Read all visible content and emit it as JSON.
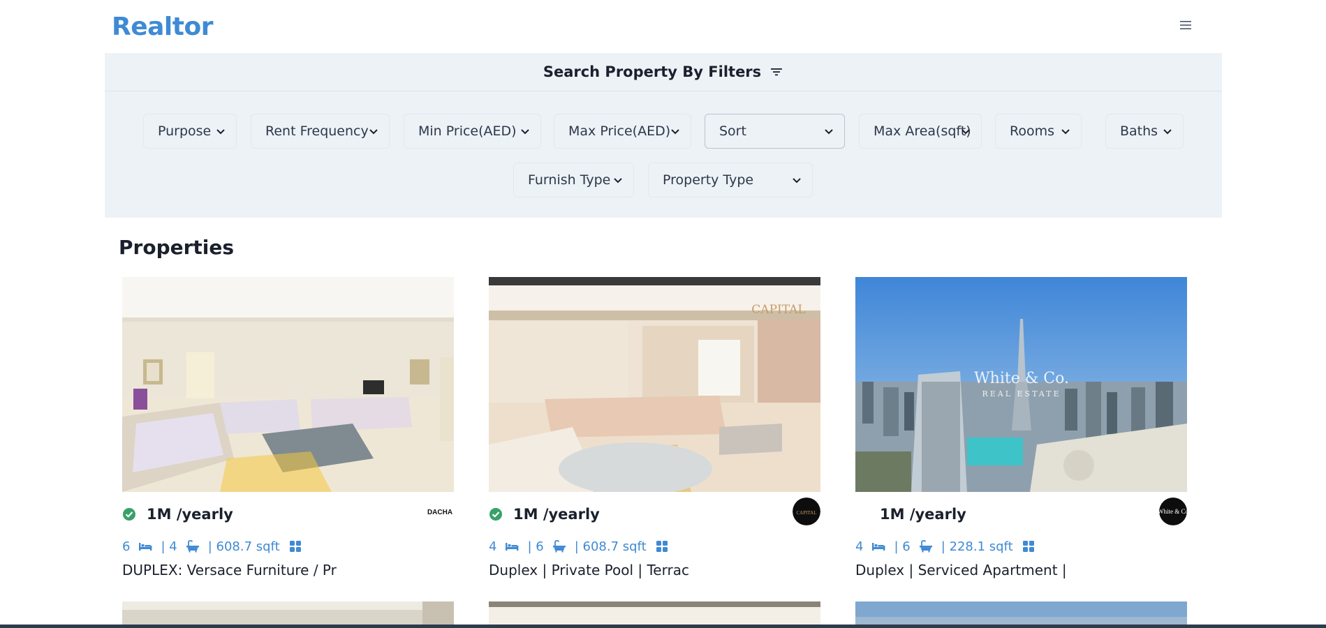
{
  "app": {
    "title": "Realtor"
  },
  "filters": {
    "heading": "Search Property By Filters",
    "items": [
      {
        "label": "Purpose"
      },
      {
        "label": "Rent Frequency"
      },
      {
        "label": "Min Price(AED)"
      },
      {
        "label": "Max Price(AED)"
      },
      {
        "label": "Sort"
      },
      {
        "label": "Max Area(sqft)"
      },
      {
        "label": "Rooms"
      },
      {
        "label": "Baths"
      },
      {
        "label": "Furnish Type"
      },
      {
        "label": "Property Type"
      }
    ]
  },
  "section": {
    "title": "Properties"
  },
  "properties": [
    {
      "price": "1M /yearly",
      "verified": true,
      "rooms": "6",
      "baths": "| 4",
      "area": "| 608.7 sqft",
      "title": "DUPLEX: Versace Furniture / Pr",
      "agency_logo_text": "DACHA"
    },
    {
      "price": "1M /yearly",
      "verified": true,
      "rooms": "4",
      "baths": "| 6",
      "area": "| 608.7 sqft",
      "title": "Duplex | Private Pool | Terrac",
      "agency_logo_text": "CAPITAL"
    },
    {
      "price": "1M /yearly",
      "verified": false,
      "rooms": "4",
      "baths": "| 6",
      "area": "| 228.1 sqft",
      "title": "Duplex | Serviced Apartment |",
      "agency_logo_text": "White & Co"
    }
  ],
  "photo_watermarks": {
    "card2": "CAPITAL",
    "card3_line1": "White & Co.",
    "card3_line2": "REAL ESTATE"
  },
  "colors": {
    "brand": "#3f8ad4",
    "panel": "#edf2f7",
    "verified": "#38a169",
    "text": "#1a202c"
  },
  "icons": {
    "menu": "hamburger-icon",
    "filter": "filter-lines-icon",
    "bed": "bed-icon",
    "bath": "bath-icon",
    "area": "grid-icon",
    "verified": "verified-badge-icon"
  }
}
